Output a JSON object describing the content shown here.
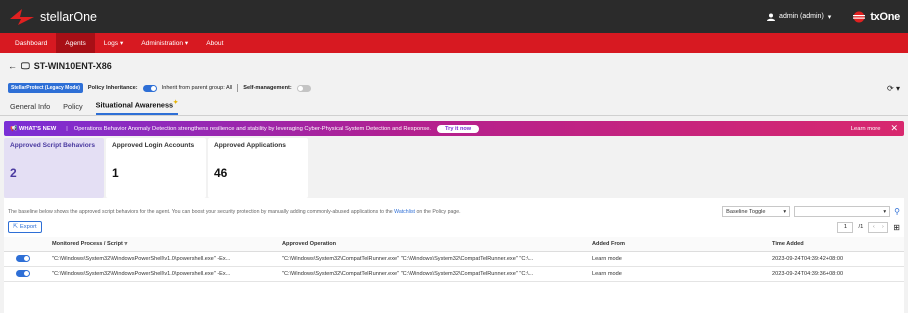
{
  "header": {
    "app_name": "stellarOne",
    "user_label": "admin (admin)",
    "brand": "txOne"
  },
  "nav": [
    "Dashboard",
    "Agents",
    "Logs",
    "Administration",
    "About"
  ],
  "page": {
    "title": "ST-WIN10ENT-X86"
  },
  "policy": {
    "badge": "StellarProtect (Legacy Mode)",
    "inheritance_label": "Policy Inheritance:",
    "inherit_text": "Inherit from parent group: All",
    "self_mgmt_label": "Self-management:"
  },
  "tabs": [
    "General Info",
    "Policy",
    "Situational Awareness"
  ],
  "banner": {
    "tag": "WHAT'S NEW",
    "message": "Operations Behavior Anomaly Detection strengthens resilience and stability by leveraging Cyber-Physical System Detection and Response.",
    "try_label": "Try it now",
    "learn_more": "Learn more"
  },
  "cards": [
    {
      "title": "Approved Script Behaviors",
      "value": "2"
    },
    {
      "title": "Approved Login Accounts",
      "value": "1"
    },
    {
      "title": "Approved Applications",
      "value": "46"
    }
  ],
  "description": {
    "before": "The baseline below shows the approved script behaviors for the agent. You can boost your security protection by manually adding commonly-abused applications to the",
    "link": "Watchlist",
    "after": "on the Policy page."
  },
  "filters": {
    "toggle_label": "Baseline Toggle"
  },
  "toolbar": {
    "export_label": "Export"
  },
  "pager": {
    "page": "1",
    "total": "/1"
  },
  "table": {
    "headers": [
      "Monitored Process / Script",
      "Approved Operation",
      "Added From",
      "Time Added"
    ],
    "rows": [
      {
        "process": "\"C:\\Windows\\System32\\WindowsPowerShell\\v1.0\\powershell.exe\" -Ex...",
        "operation": "\"C:\\Windows\\System32\\CompatTelRunner.exe\" \"C:\\Windows\\System32\\CompatTelRunner.exe\" \"C:\\...",
        "added_from": "Learn mode",
        "time": "2023-09-24T04:39:42+08:00"
      },
      {
        "process": "\"C:\\Windows\\System32\\WindowsPowerShell\\v1.0\\powershell.exe\" -Ex...",
        "operation": "\"C:\\Windows\\System32\\CompatTelRunner.exe\" \"C:\\Windows\\System32\\CompatTelRunner.exe\" \"C:\\...",
        "added_from": "Learn mode",
        "time": "2023-09-24T04:39:36+08:00"
      }
    ]
  },
  "colors": {
    "nav_red": "#d71921",
    "accent_blue": "#2e6fd6",
    "banner_purple": "#7a2fd6"
  }
}
